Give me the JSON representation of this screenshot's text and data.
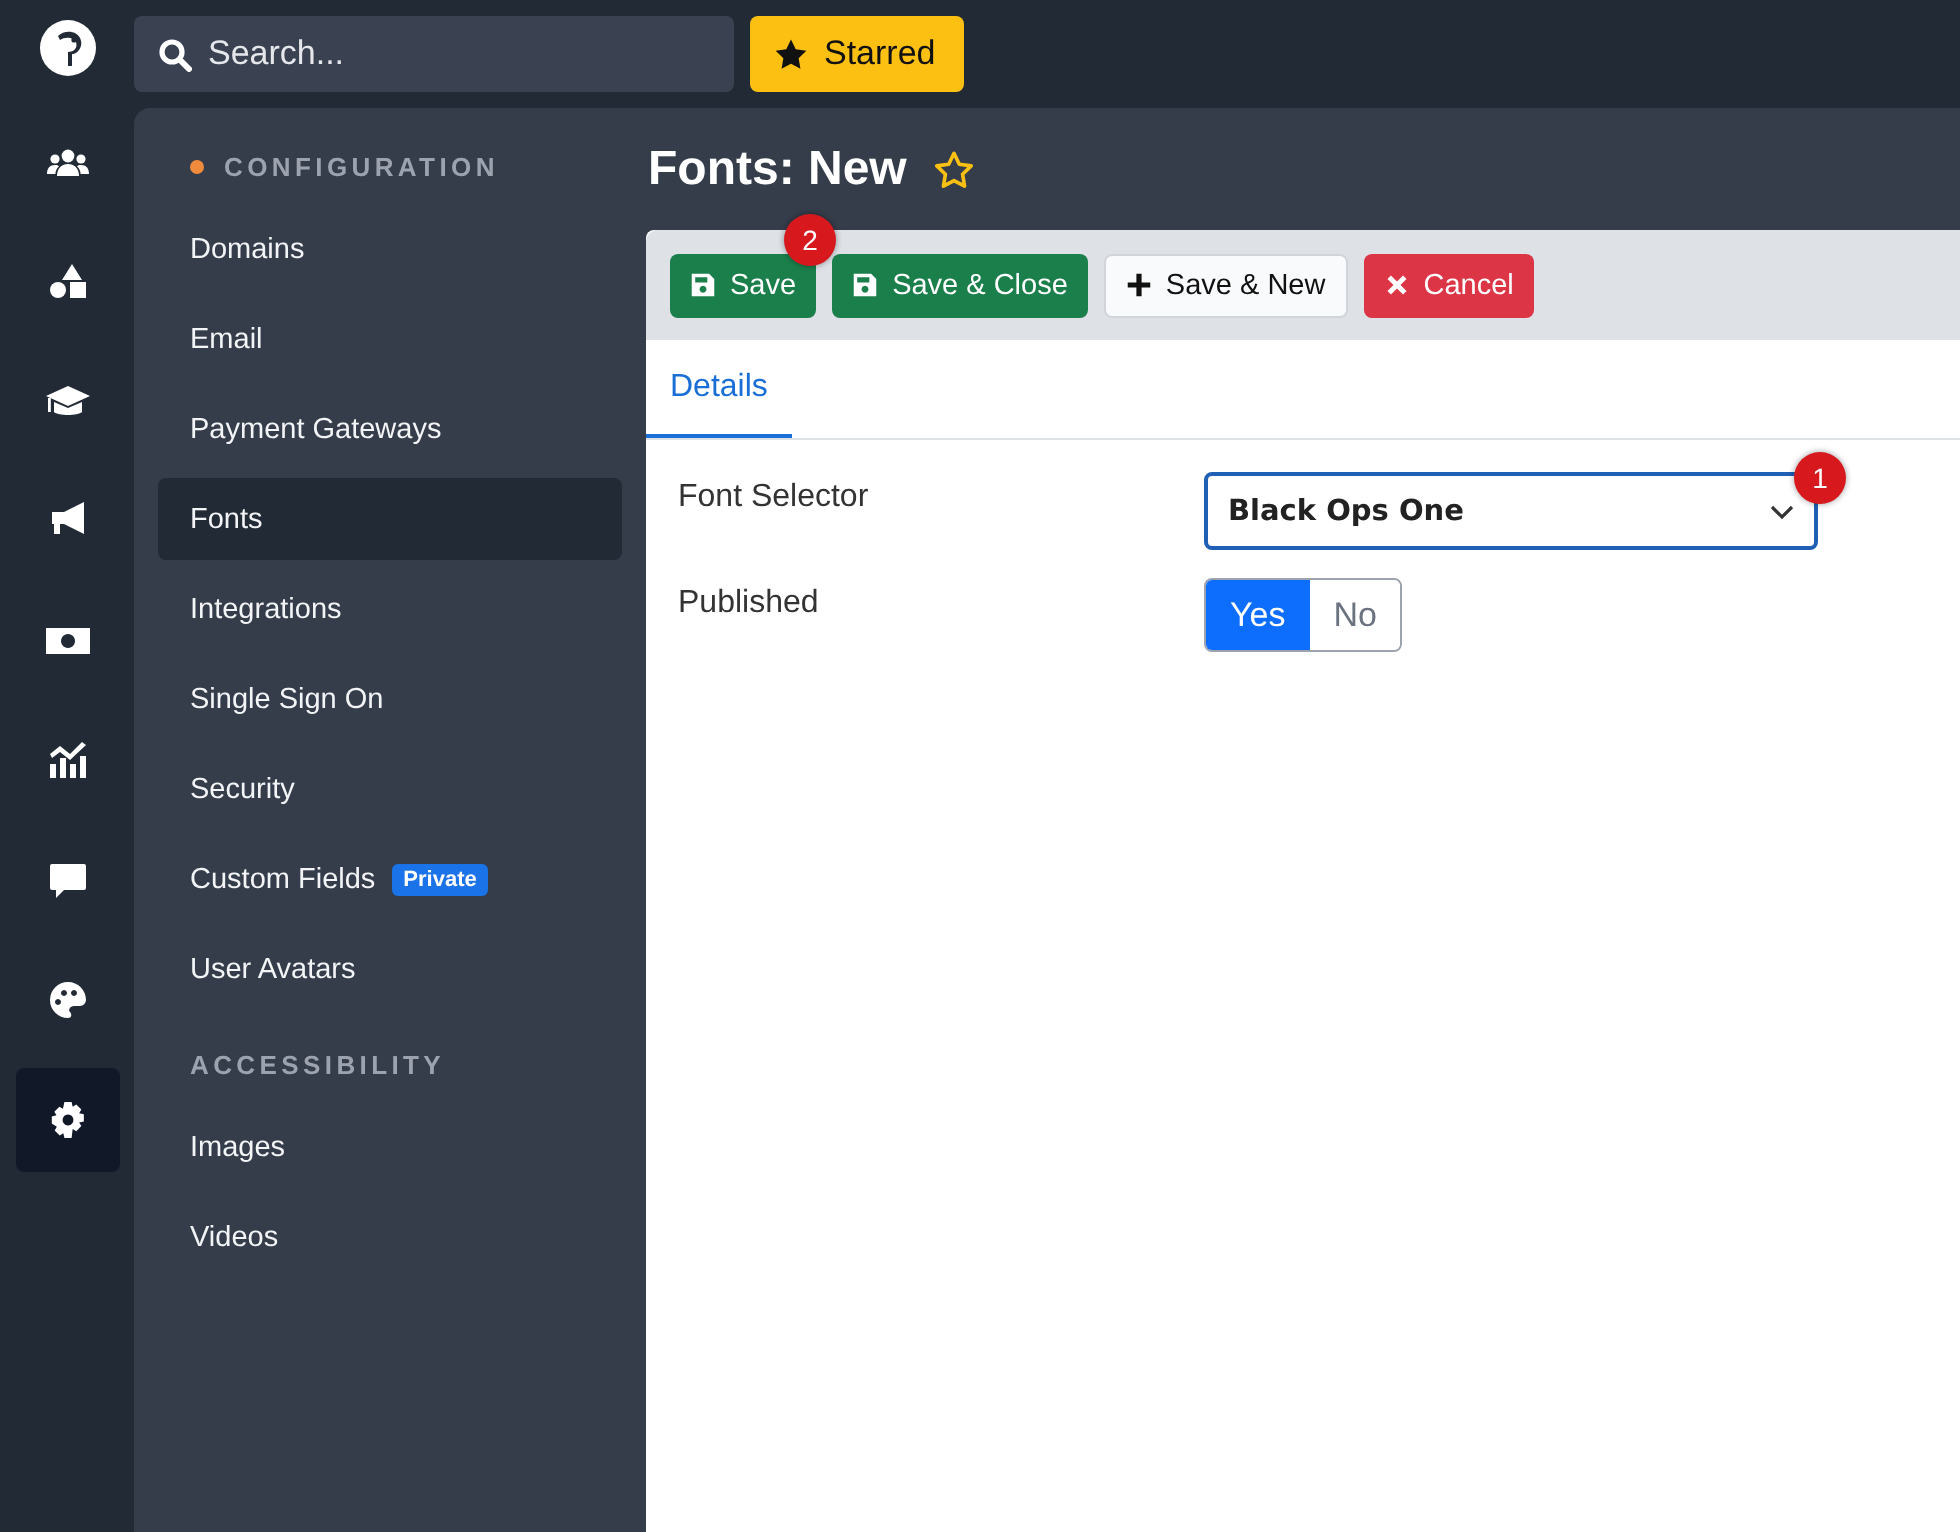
{
  "rail": {
    "items": [
      {
        "selected": false
      },
      {
        "selected": false
      },
      {
        "selected": false
      },
      {
        "selected": false
      },
      {
        "selected": false
      },
      {
        "selected": false
      },
      {
        "selected": false
      },
      {
        "selected": false
      },
      {
        "selected": true
      }
    ]
  },
  "search": {
    "placeholder": "Search..."
  },
  "starred_button": {
    "label": "Starred"
  },
  "sidebar": {
    "sections": [
      {
        "heading": "CONFIGURATION",
        "active": true,
        "items": [
          {
            "label": "Domains",
            "selected": false
          },
          {
            "label": "Email",
            "selected": false
          },
          {
            "label": "Payment Gateways",
            "selected": false
          },
          {
            "label": "Fonts",
            "selected": true
          },
          {
            "label": "Integrations",
            "selected": false
          },
          {
            "label": "Single Sign On",
            "selected": false
          },
          {
            "label": "Security",
            "selected": false
          },
          {
            "label": "Custom Fields",
            "selected": false,
            "badge": "Private"
          },
          {
            "label": "User Avatars",
            "selected": false
          }
        ]
      },
      {
        "heading": "ACCESSIBILITY",
        "active": false,
        "items": [
          {
            "label": "Images",
            "selected": false
          },
          {
            "label": "Videos",
            "selected": false
          }
        ]
      }
    ]
  },
  "page_title": "Fonts: New",
  "toolbar": {
    "buttons": [
      {
        "label": "Save",
        "kind": "success",
        "marker": "2"
      },
      {
        "label": "Save & Close",
        "kind": "success"
      },
      {
        "label": "Save & New",
        "kind": "light"
      },
      {
        "label": "Cancel",
        "kind": "danger"
      }
    ]
  },
  "tabs": [
    {
      "label": "Details",
      "selected": true
    }
  ],
  "form": {
    "fields": [
      {
        "label": "Font Selector",
        "kind": "select",
        "value": "Black Ops One",
        "marker": "1"
      },
      {
        "label": "Published",
        "kind": "toggle",
        "options": [
          {
            "label": "Yes",
            "selected": true
          },
          {
            "label": "No",
            "selected": false
          }
        ]
      }
    ]
  }
}
